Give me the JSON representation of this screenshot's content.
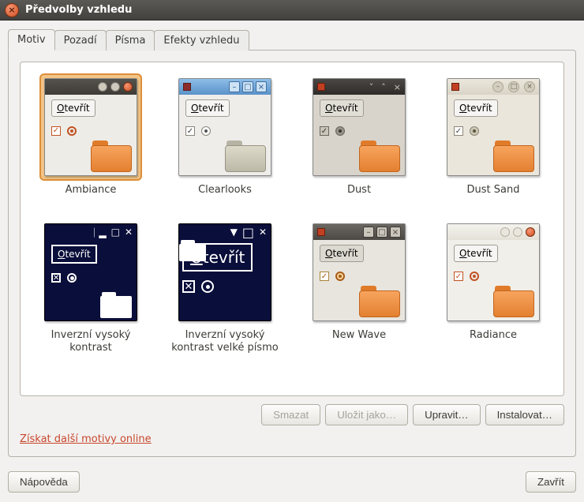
{
  "window": {
    "title": "Předvolby vzhledu"
  },
  "tabs": {
    "motiv": "Motiv",
    "pozadi": "Pozadí",
    "pisma": "Písma",
    "efekty": "Efekty vzhledu"
  },
  "themes": {
    "open_label": "Otevřít",
    "items": [
      {
        "name": "Ambiance",
        "selected": true
      },
      {
        "name": "Clearlooks"
      },
      {
        "name": "Dust"
      },
      {
        "name": "Dust Sand"
      },
      {
        "name": "Inverzní vysoký kontrast"
      },
      {
        "name": "Inverzní vysoký kontrast velké písmo"
      },
      {
        "name": "New Wave"
      },
      {
        "name": "Radiance"
      }
    ]
  },
  "actions": {
    "delete": "Smazat",
    "save_as": "Uložit jako…",
    "customize": "Upravit…",
    "install": "Instalovat…"
  },
  "link": {
    "more_themes": "Získat další motivy online"
  },
  "footer": {
    "help": "Nápověda",
    "close": "Zavřít"
  }
}
